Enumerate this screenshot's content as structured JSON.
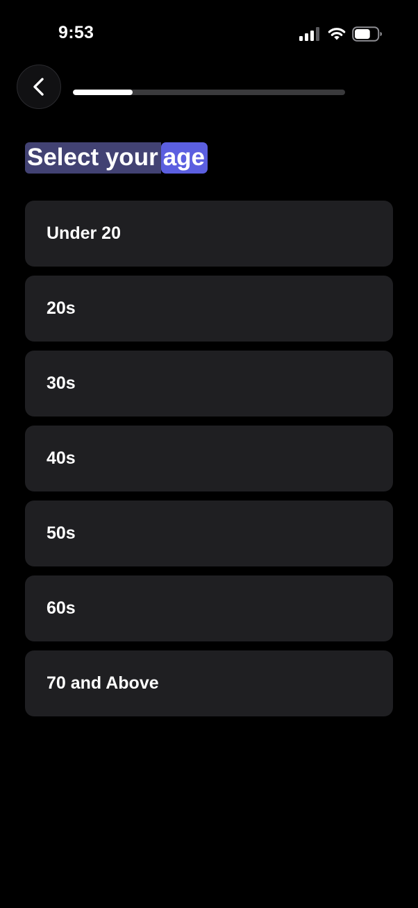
{
  "status_bar": {
    "time": "9:53",
    "signal_icon": "cellular-signal-icon",
    "wifi_icon": "wifi-icon",
    "battery_icon": "battery-icon",
    "battery_level": 0.7
  },
  "header": {
    "back_icon": "chevron-left-icon",
    "progress": 0.22,
    "colors": {
      "progress_fill": "#ffffff",
      "progress_track": "#3a3a3c"
    }
  },
  "title": {
    "text_main": "Select your ",
    "text_highlight": "age",
    "highlight_color": "#5b5fe0"
  },
  "options": [
    {
      "label": "Under 20"
    },
    {
      "label": "20s"
    },
    {
      "label": "30s"
    },
    {
      "label": "40s"
    },
    {
      "label": "50s"
    },
    {
      "label": "60s"
    },
    {
      "label": "70 and Above"
    }
  ],
  "colors": {
    "background": "#000000",
    "option_background": "#1f1f22",
    "text": "#ffffff"
  }
}
